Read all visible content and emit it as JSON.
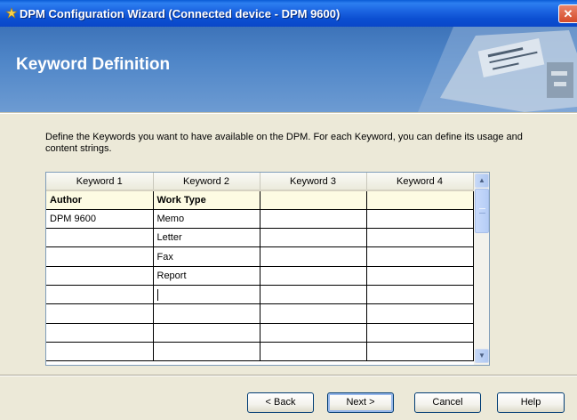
{
  "window": {
    "title": "DPM Configuration Wizard (Connected device - DPM 9600)",
    "close_glyph": "✕"
  },
  "header": {
    "title": "Keyword Definition"
  },
  "instructions": "Define the Keywords you want to have available on the DPM. For each Keyword, you can define its usage and content strings.",
  "grid": {
    "columns": [
      "Keyword 1",
      "Keyword 2",
      "Keyword 3",
      "Keyword 4"
    ],
    "keyword_names": [
      "Author",
      "Work Type",
      "",
      ""
    ],
    "rows": [
      [
        "DPM 9600",
        "Memo",
        "",
        ""
      ],
      [
        "",
        "Letter",
        "",
        ""
      ],
      [
        "",
        "Fax",
        "",
        ""
      ],
      [
        "",
        "Report",
        "",
        ""
      ],
      [
        "",
        "",
        "",
        ""
      ],
      [
        "",
        "",
        "",
        ""
      ],
      [
        "",
        "",
        "",
        ""
      ],
      [
        "",
        "",
        "",
        ""
      ]
    ],
    "scroll_up_glyph": "▲",
    "scroll_down_glyph": "▼"
  },
  "buttons": {
    "back": "< Back",
    "next": "Next >",
    "cancel": "Cancel",
    "help": "Help"
  },
  "icons": {
    "app": "wizard-icon",
    "close": "close-icon"
  }
}
